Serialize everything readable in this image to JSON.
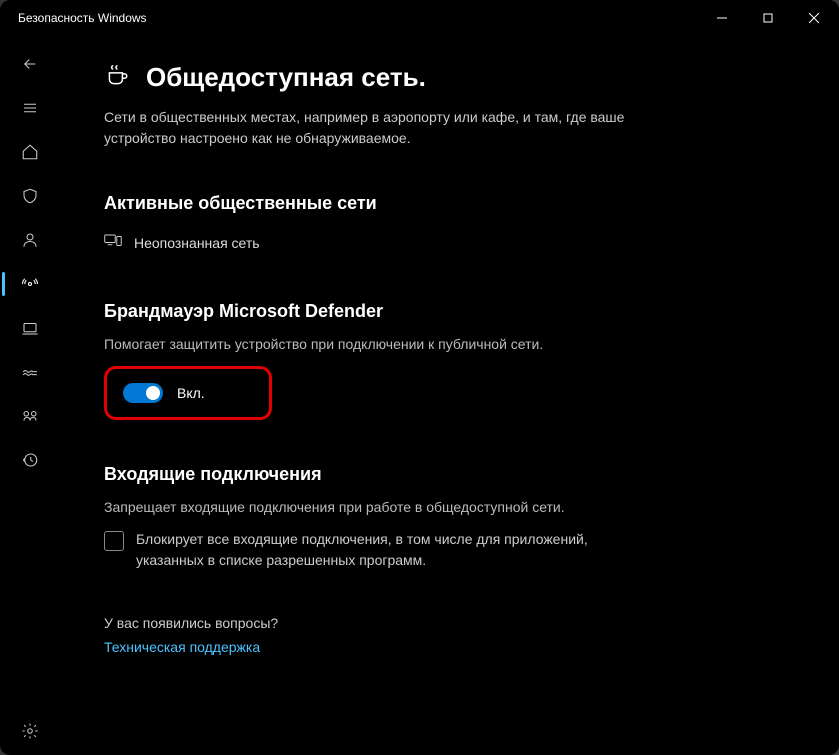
{
  "window": {
    "title": "Безопасность Windows"
  },
  "page": {
    "title": "Общедоступная сеть.",
    "subtitle": "Сети в общественных местах, например в аэропорту или кафе, и там, где ваше устройство настроено как не обнаруживаемое."
  },
  "active_networks": {
    "heading": "Активные общественные сети",
    "item": "Неопознанная сеть"
  },
  "firewall": {
    "heading": "Брандмауэр Microsoft Defender",
    "desc": "Помогает защитить устройство при подключении к публичной сети.",
    "toggle_label": "Вкл."
  },
  "incoming": {
    "heading": "Входящие подключения",
    "desc": "Запрещает входящие подключения при работе в общедоступной сети.",
    "checkbox_label": "Блокирует все входящие подключения, в том числе для приложений, указанных в списке разрешенных программ."
  },
  "help": {
    "questions": "У вас появились вопросы?",
    "link": "Техническая поддержка"
  }
}
